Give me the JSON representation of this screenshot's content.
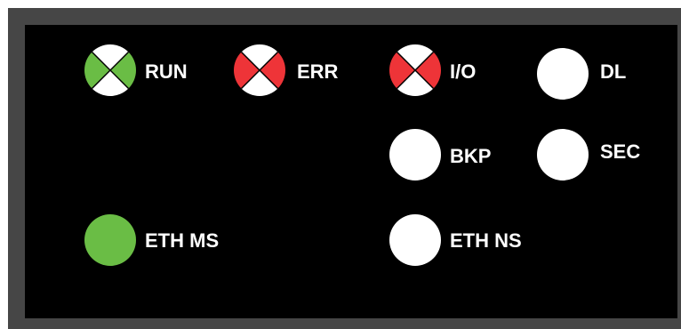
{
  "colors": {
    "frame": "#464646",
    "panel": "#000000",
    "green": "#6abd45",
    "red": "#ee3438",
    "white": "#ffffff"
  },
  "leds": [
    {
      "id": "run",
      "label": "RUN",
      "style": "bicolor",
      "color": "green"
    },
    {
      "id": "err",
      "label": "ERR",
      "style": "bicolor",
      "color": "red"
    },
    {
      "id": "io",
      "label": "I/O",
      "style": "bicolor",
      "color": "red"
    },
    {
      "id": "dl",
      "label": "DL",
      "style": "solid",
      "color": "white"
    },
    {
      "id": "bkp",
      "label": "BKP",
      "style": "solid",
      "color": "white"
    },
    {
      "id": "sec",
      "label": "SEC",
      "style": "solid",
      "color": "white"
    },
    {
      "id": "eth-ms",
      "label": "ETH MS",
      "style": "solid",
      "color": "green"
    },
    {
      "id": "eth-ns",
      "label": "ETH NS",
      "style": "solid",
      "color": "white"
    }
  ]
}
